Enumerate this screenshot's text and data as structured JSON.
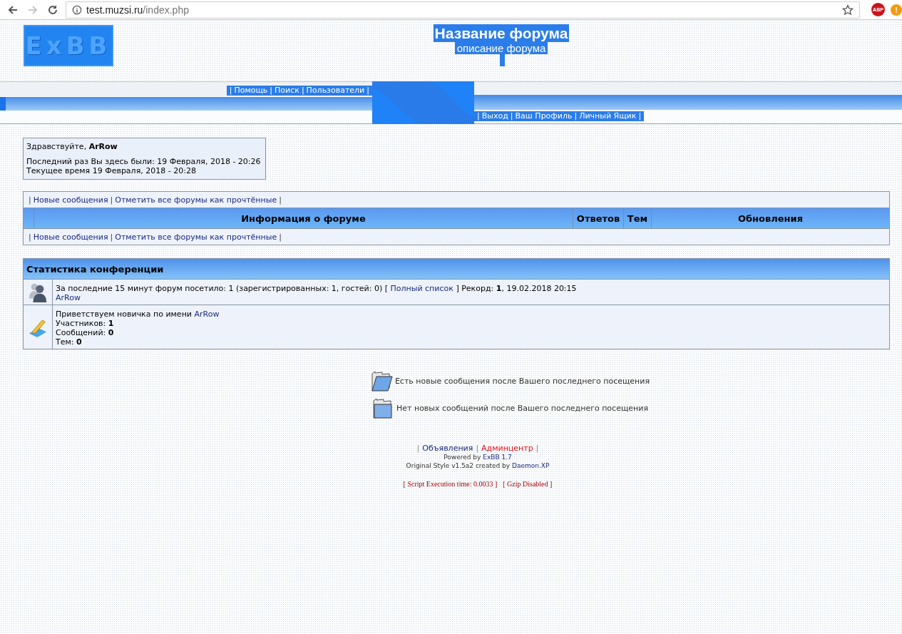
{
  "browser": {
    "host": "test.muzsi.ru",
    "path": "/index.php",
    "back_disabled": false,
    "forward_disabled": true,
    "adblock_badge": "ABP",
    "extension_badge": "!"
  },
  "header": {
    "logo_text": "ExBB",
    "title": "Название форума",
    "description": "описание форума"
  },
  "nav_top": {
    "links": [
      "Помощь",
      "Поиск",
      "Пользователи"
    ],
    "separators": [
      "|",
      "|",
      "|",
      "|"
    ]
  },
  "nav_bottom": {
    "links": [
      "Выход",
      "Ваш Профиль",
      "Личный Ящик"
    ],
    "separators": [
      "|",
      "|",
      "|",
      "|"
    ]
  },
  "welcome": {
    "greeting": "Здравствуйте, **ArRow**",
    "last_visit": "Последний раз Вы здесь были: 19 Февраля, 2018 - 20:26",
    "current_time": "Текущее время 19 Февраля, 2018 - 20:28"
  },
  "forum_table": {
    "links_top": [
      "Новые сообщения",
      "Отметить все форумы как прочтённые"
    ],
    "separators_top": [
      "|",
      "|",
      "|"
    ],
    "columns": [
      "Информация о форуме",
      "Ответов",
      "Тем",
      "Обновления"
    ],
    "links_bottom": [
      "Новые сообщения",
      "Отметить все форумы как прочтённые"
    ],
    "separators_bottom": [
      "|",
      "|",
      "|"
    ]
  },
  "stats": {
    "title": "Статистика конференции",
    "rows": [
      {
        "kind": "online",
        "before": "За последние 15 минут форум посетило: 1 (зарегистрированных: 1, гостей: 0) [",
        "link": "Полный список",
        "after": "] Рекорд: **1**, 19.02.2018 20:15",
        "user": "ArRow"
      },
      {
        "kind": "totals",
        "before": "Приветствуем новичка по имени",
        "user": "ArRow",
        "lines": [
          "Участников: **1**",
          "Сообщений: **0**",
          "Тем: **0**"
        ]
      }
    ]
  },
  "legend": [
    {
      "kind": "new",
      "text": "Есть новые сообщения после Вашего последнего посещения"
    },
    {
      "kind": "none",
      "text": "Нет новых сообщений после Вашего последнего посещения"
    }
  ],
  "footer": {
    "links": [
      {
        "text": "Объявления",
        "kind": "normal"
      },
      {
        "text": "Админцентр",
        "kind": "admin"
      }
    ],
    "separators": [
      "|",
      "|",
      "|"
    ],
    "powered": "Powered by",
    "powered_link": "ExBB 1.7",
    "style": "Original Style v1.5a2 created by",
    "style_link": "Daemon.XP",
    "exec": [
      "[ Script Execution time: 0.0033 ]",
      "[ Gzip Disabled ]"
    ]
  }
}
